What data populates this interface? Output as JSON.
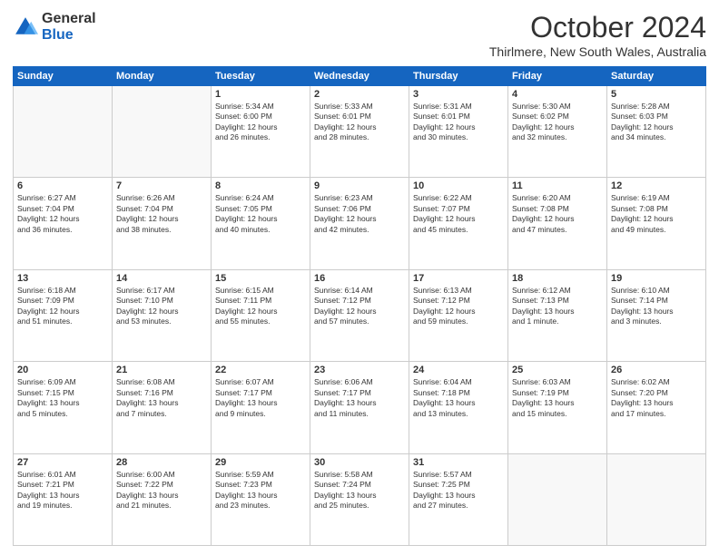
{
  "logo": {
    "general": "General",
    "blue": "Blue"
  },
  "header": {
    "title": "October 2024",
    "subtitle": "Thirlmere, New South Wales, Australia"
  },
  "weekdays": [
    "Sunday",
    "Monday",
    "Tuesday",
    "Wednesday",
    "Thursday",
    "Friday",
    "Saturday"
  ],
  "weeks": [
    [
      {
        "day": "",
        "info": ""
      },
      {
        "day": "",
        "info": ""
      },
      {
        "day": "1",
        "info": "Sunrise: 5:34 AM\nSunset: 6:00 PM\nDaylight: 12 hours\nand 26 minutes."
      },
      {
        "day": "2",
        "info": "Sunrise: 5:33 AM\nSunset: 6:01 PM\nDaylight: 12 hours\nand 28 minutes."
      },
      {
        "day": "3",
        "info": "Sunrise: 5:31 AM\nSunset: 6:01 PM\nDaylight: 12 hours\nand 30 minutes."
      },
      {
        "day": "4",
        "info": "Sunrise: 5:30 AM\nSunset: 6:02 PM\nDaylight: 12 hours\nand 32 minutes."
      },
      {
        "day": "5",
        "info": "Sunrise: 5:28 AM\nSunset: 6:03 PM\nDaylight: 12 hours\nand 34 minutes."
      }
    ],
    [
      {
        "day": "6",
        "info": "Sunrise: 6:27 AM\nSunset: 7:04 PM\nDaylight: 12 hours\nand 36 minutes."
      },
      {
        "day": "7",
        "info": "Sunrise: 6:26 AM\nSunset: 7:04 PM\nDaylight: 12 hours\nand 38 minutes."
      },
      {
        "day": "8",
        "info": "Sunrise: 6:24 AM\nSunset: 7:05 PM\nDaylight: 12 hours\nand 40 minutes."
      },
      {
        "day": "9",
        "info": "Sunrise: 6:23 AM\nSunset: 7:06 PM\nDaylight: 12 hours\nand 42 minutes."
      },
      {
        "day": "10",
        "info": "Sunrise: 6:22 AM\nSunset: 7:07 PM\nDaylight: 12 hours\nand 45 minutes."
      },
      {
        "day": "11",
        "info": "Sunrise: 6:20 AM\nSunset: 7:08 PM\nDaylight: 12 hours\nand 47 minutes."
      },
      {
        "day": "12",
        "info": "Sunrise: 6:19 AM\nSunset: 7:08 PM\nDaylight: 12 hours\nand 49 minutes."
      }
    ],
    [
      {
        "day": "13",
        "info": "Sunrise: 6:18 AM\nSunset: 7:09 PM\nDaylight: 12 hours\nand 51 minutes."
      },
      {
        "day": "14",
        "info": "Sunrise: 6:17 AM\nSunset: 7:10 PM\nDaylight: 12 hours\nand 53 minutes."
      },
      {
        "day": "15",
        "info": "Sunrise: 6:15 AM\nSunset: 7:11 PM\nDaylight: 12 hours\nand 55 minutes."
      },
      {
        "day": "16",
        "info": "Sunrise: 6:14 AM\nSunset: 7:12 PM\nDaylight: 12 hours\nand 57 minutes."
      },
      {
        "day": "17",
        "info": "Sunrise: 6:13 AM\nSunset: 7:12 PM\nDaylight: 12 hours\nand 59 minutes."
      },
      {
        "day": "18",
        "info": "Sunrise: 6:12 AM\nSunset: 7:13 PM\nDaylight: 13 hours\nand 1 minute."
      },
      {
        "day": "19",
        "info": "Sunrise: 6:10 AM\nSunset: 7:14 PM\nDaylight: 13 hours\nand 3 minutes."
      }
    ],
    [
      {
        "day": "20",
        "info": "Sunrise: 6:09 AM\nSunset: 7:15 PM\nDaylight: 13 hours\nand 5 minutes."
      },
      {
        "day": "21",
        "info": "Sunrise: 6:08 AM\nSunset: 7:16 PM\nDaylight: 13 hours\nand 7 minutes."
      },
      {
        "day": "22",
        "info": "Sunrise: 6:07 AM\nSunset: 7:17 PM\nDaylight: 13 hours\nand 9 minutes."
      },
      {
        "day": "23",
        "info": "Sunrise: 6:06 AM\nSunset: 7:17 PM\nDaylight: 13 hours\nand 11 minutes."
      },
      {
        "day": "24",
        "info": "Sunrise: 6:04 AM\nSunset: 7:18 PM\nDaylight: 13 hours\nand 13 minutes."
      },
      {
        "day": "25",
        "info": "Sunrise: 6:03 AM\nSunset: 7:19 PM\nDaylight: 13 hours\nand 15 minutes."
      },
      {
        "day": "26",
        "info": "Sunrise: 6:02 AM\nSunset: 7:20 PM\nDaylight: 13 hours\nand 17 minutes."
      }
    ],
    [
      {
        "day": "27",
        "info": "Sunrise: 6:01 AM\nSunset: 7:21 PM\nDaylight: 13 hours\nand 19 minutes."
      },
      {
        "day": "28",
        "info": "Sunrise: 6:00 AM\nSunset: 7:22 PM\nDaylight: 13 hours\nand 21 minutes."
      },
      {
        "day": "29",
        "info": "Sunrise: 5:59 AM\nSunset: 7:23 PM\nDaylight: 13 hours\nand 23 minutes."
      },
      {
        "day": "30",
        "info": "Sunrise: 5:58 AM\nSunset: 7:24 PM\nDaylight: 13 hours\nand 25 minutes."
      },
      {
        "day": "31",
        "info": "Sunrise: 5:57 AM\nSunset: 7:25 PM\nDaylight: 13 hours\nand 27 minutes."
      },
      {
        "day": "",
        "info": ""
      },
      {
        "day": "",
        "info": ""
      }
    ]
  ]
}
